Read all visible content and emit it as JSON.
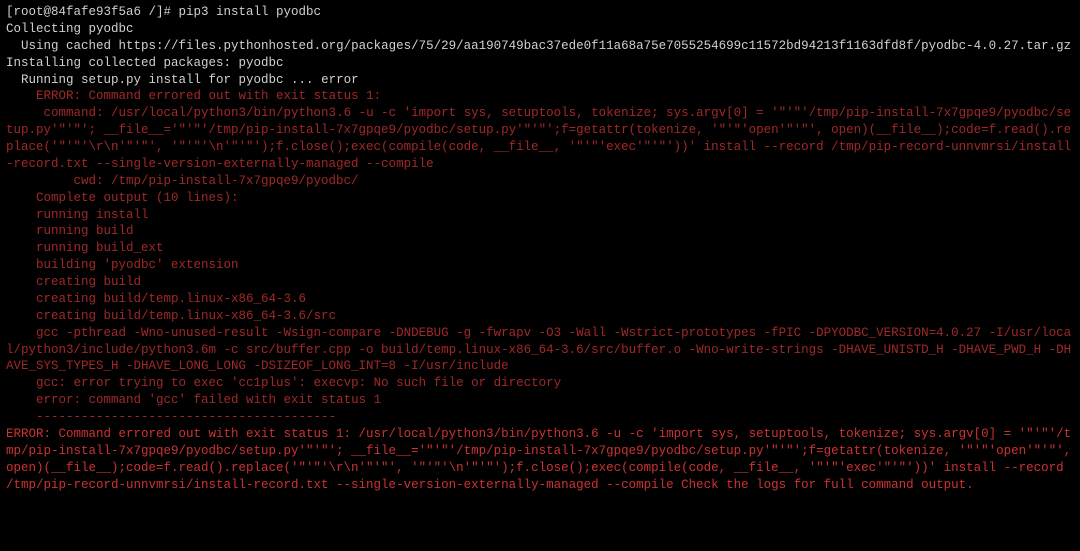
{
  "lines": [
    {
      "cls": "white",
      "text": "[root@84fafe93f5a6 /]# pip3 install pyodbc"
    },
    {
      "cls": "white",
      "text": "Collecting pyodbc"
    },
    {
      "cls": "white",
      "text": "  Using cached https://files.pythonhosted.org/packages/75/29/aa190749bac37ede0f11a68a75e7055254699c11572bd94213f1163dfd8f/pyodbc-4.0.27.tar.gz"
    },
    {
      "cls": "white",
      "text": "Installing collected packages: pyodbc"
    },
    {
      "cls": "white",
      "text": "  Running setup.py install for pyodbc ... error"
    },
    {
      "cls": "dimred",
      "text": "    ERROR: Command errored out with exit status 1:"
    },
    {
      "cls": "dimred",
      "text": "     command: /usr/local/python3/bin/python3.6 -u -c 'import sys, setuptools, tokenize; sys.argv[0] = '\"'\"'/tmp/pip-install-7x7gpqe9/pyodbc/setup.py'\"'\"'; __file__='\"'\"'/tmp/pip-install-7x7gpqe9/pyodbc/setup.py'\"'\"';f=getattr(tokenize, '\"'\"'open'\"'\"', open)(__file__);code=f.read().replace('\"'\"'\\r\\n'\"'\"', '\"'\"'\\n'\"'\"');f.close();exec(compile(code, __file__, '\"'\"'exec'\"'\"'))' install --record /tmp/pip-record-unnvmrsi/install-record.txt --single-version-externally-managed --compile"
    },
    {
      "cls": "dimred",
      "text": "         cwd: /tmp/pip-install-7x7gpqe9/pyodbc/"
    },
    {
      "cls": "dimred",
      "text": "    Complete output (10 lines):"
    },
    {
      "cls": "dimred",
      "text": "    running install"
    },
    {
      "cls": "dimred",
      "text": "    running build"
    },
    {
      "cls": "dimred",
      "text": "    running build_ext"
    },
    {
      "cls": "dimred",
      "text": "    building 'pyodbc' extension"
    },
    {
      "cls": "dimred",
      "text": "    creating build"
    },
    {
      "cls": "dimred",
      "text": "    creating build/temp.linux-x86_64-3.6"
    },
    {
      "cls": "dimred",
      "text": "    creating build/temp.linux-x86_64-3.6/src"
    },
    {
      "cls": "dimred",
      "text": "    gcc -pthread -Wno-unused-result -Wsign-compare -DNDEBUG -g -fwrapv -O3 -Wall -Wstrict-prototypes -fPIC -DPYODBC_VERSION=4.0.27 -I/usr/local/python3/include/python3.6m -c src/buffer.cpp -o build/temp.linux-x86_64-3.6/src/buffer.o -Wno-write-strings -DHAVE_UNISTD_H -DHAVE_PWD_H -DHAVE_SYS_TYPES_H -DHAVE_LONG_LONG -DSIZEOF_LONG_INT=8 -I/usr/include"
    },
    {
      "cls": "dimred",
      "text": "    gcc: error trying to exec 'cc1plus': execvp: No such file or directory"
    },
    {
      "cls": "dimred",
      "text": "    error: command 'gcc' failed with exit status 1"
    },
    {
      "cls": "dimred",
      "text": "    ----------------------------------------"
    },
    {
      "cls": "red",
      "text": "ERROR: Command errored out with exit status 1: /usr/local/python3/bin/python3.6 -u -c 'import sys, setuptools, tokenize; sys.argv[0] = '\"'\"'/tmp/pip-install-7x7gpqe9/pyodbc/setup.py'\"'\"'; __file__='\"'\"'/tmp/pip-install-7x7gpqe9/pyodbc/setup.py'\"'\"';f=getattr(tokenize, '\"'\"'open'\"'\"', open)(__file__);code=f.read().replace('\"'\"'\\r\\n'\"'\"', '\"'\"'\\n'\"'\"');f.close();exec(compile(code, __file__, '\"'\"'exec'\"'\"'))' install --record /tmp/pip-record-unnvmrsi/install-record.txt --single-version-externally-managed --compile Check the logs for full command output."
    }
  ]
}
